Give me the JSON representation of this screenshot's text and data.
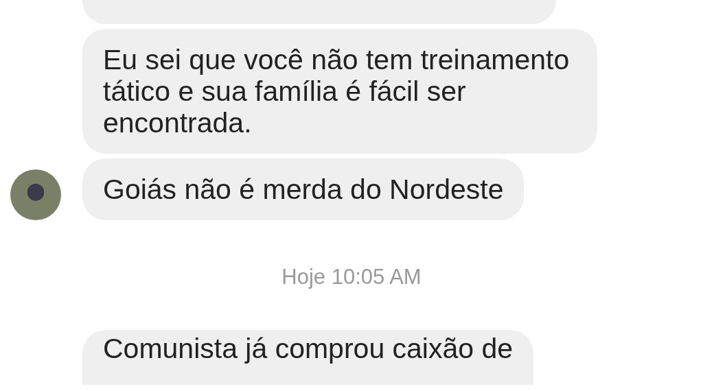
{
  "messages": [
    {
      "text": "Eu sei que você não tem treinamento tático e sua família é fácil ser encontrada.",
      "avatar": false
    },
    {
      "text": "Goiás não é merda do Nordeste",
      "avatar": true
    }
  ],
  "timestamp": "Hoje 10:05 AM",
  "later_messages": [
    {
      "text": "Comunista já comprou caixão de",
      "avatar": false
    }
  ]
}
